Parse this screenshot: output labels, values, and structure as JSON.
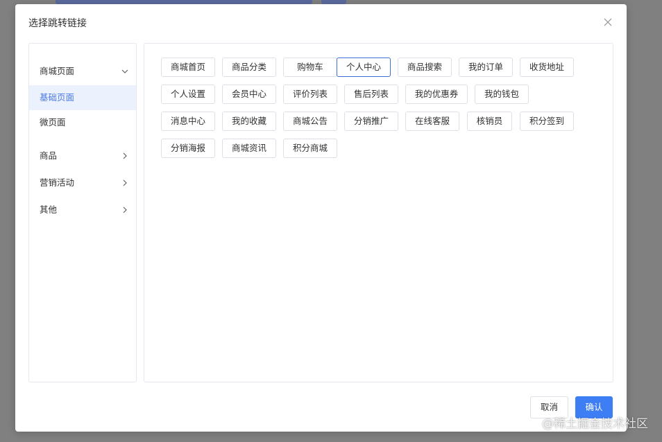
{
  "dialog": {
    "title": "选择跳转链接"
  },
  "sidebar": {
    "items": [
      {
        "label": "商城页面",
        "arrow": "chevron-down"
      },
      {
        "label": "基础页面",
        "active": true
      },
      {
        "label": "微页面"
      },
      {
        "label": "商品",
        "arrow": "chevron-right"
      },
      {
        "label": "营销活动",
        "arrow": "chevron-right"
      },
      {
        "label": "其他",
        "arrow": "chevron-right"
      }
    ]
  },
  "links": [
    "商城首页",
    "商品分类",
    "购物车",
    "个人中心",
    "商品搜索",
    "我的订单",
    "收货地址",
    "个人设置",
    "会员中心",
    "评价列表",
    "售后列表",
    "我的优惠券",
    "我的钱包",
    "消息中心",
    "我的收藏",
    "商城公告",
    "分销推广",
    "在线客服",
    "核销员",
    "积分签到",
    "分销海报",
    "商城资讯",
    "积分商城"
  ],
  "selected_link": "个人中心",
  "footer": {
    "cancel_label": "取消",
    "confirm_label": "确认"
  },
  "watermark": "@稀土掘金技术社区",
  "colors": {
    "accent": "#3d7ef5",
    "active_bg": "#ecf2fd",
    "active_text": "#4a78e6"
  }
}
